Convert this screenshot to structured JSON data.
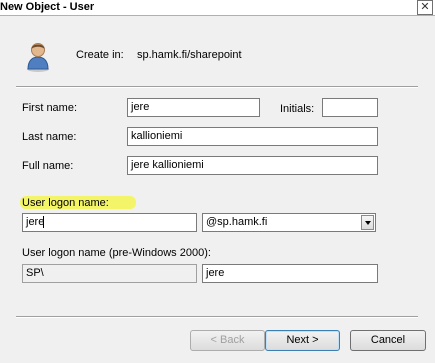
{
  "window": {
    "title": "New Object - User",
    "close_glyph": "✕"
  },
  "header": {
    "create_in_label": "Create in:",
    "create_in_path": "sp.hamk.fi/sharepoint"
  },
  "form": {
    "first_name_label": "First name:",
    "first_name_value": "jere",
    "initials_label": "Initials:",
    "initials_value": "",
    "last_name_label": "Last name:",
    "last_name_value": "kallioniemi",
    "full_name_label": "Full name:",
    "full_name_value": "jere kallioniemi",
    "logon_name_label": "User logon name:",
    "logon_name_value": "jere",
    "domain_value": "@sp.hamk.fi",
    "pre2000_label": "User logon name (pre-Windows 2000):",
    "pre2000_domain_value": "SP\\",
    "pre2000_name_value": "jere"
  },
  "buttons": {
    "back": "< Back",
    "next": "Next >",
    "cancel": "Cancel"
  },
  "colors": {
    "highlight": "#f4f45a",
    "background": "#f0f0f0"
  },
  "icons": {
    "user": "user-icon",
    "close": "close-icon",
    "dropdown": "chevron-down-icon"
  }
}
